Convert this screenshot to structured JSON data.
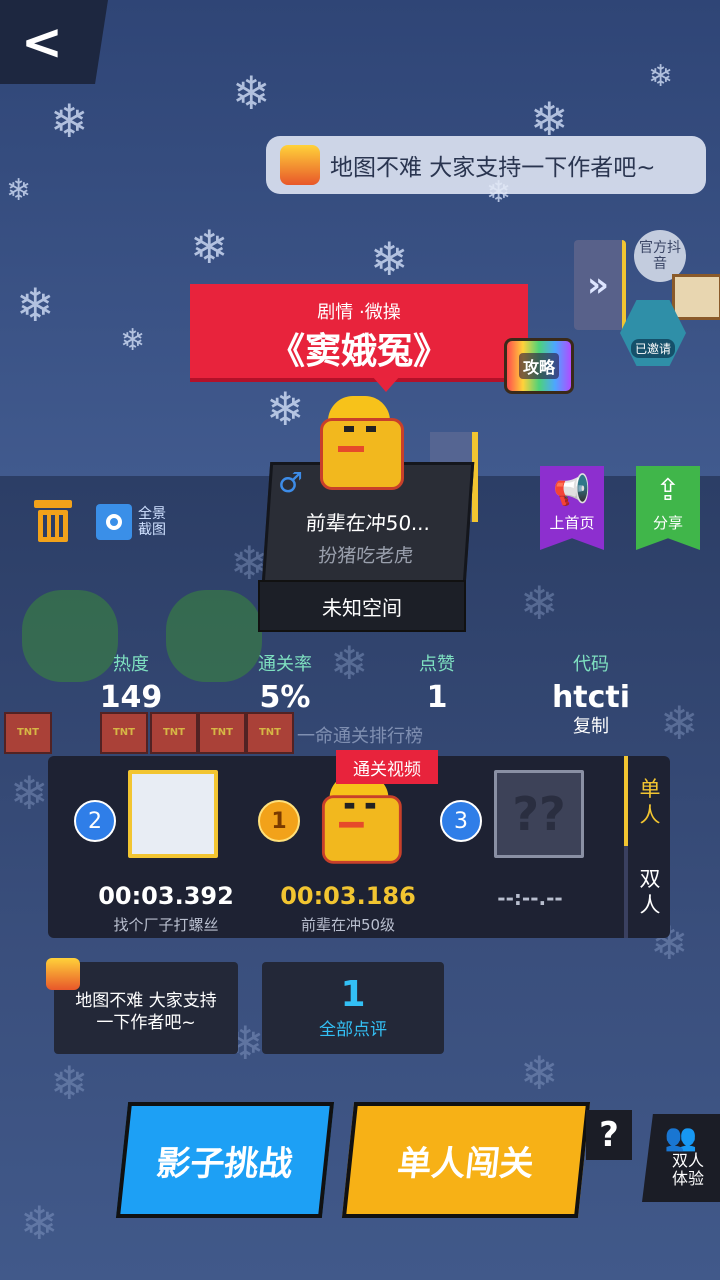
{
  "header": {
    "back_icon": "chevron-left-icon",
    "message": "地图不难 大家支持一下作者吧~"
  },
  "side": {
    "douyin_label": "官方抖音",
    "arrow_icon": "double-chevron-right-icon",
    "badge_label": "已邀请"
  },
  "level": {
    "tags": "剧情 ·微操",
    "title": "《窦娥冤》",
    "guide_label": "攻略"
  },
  "author": {
    "gender_icon": "male-icon",
    "name": "前辈在冲50...",
    "title": "扮猪吃老虎",
    "space": "未知空间"
  },
  "tools": {
    "screenshot_label": "全景截图"
  },
  "actions": {
    "home_label": "上首页",
    "share_label": "分享"
  },
  "stats": {
    "heat_label": "热度",
    "heat_value": "149",
    "pass_label": "通关率",
    "pass_value": "5%",
    "likes_label": "点赞",
    "likes_value": "1",
    "code_label": "代码",
    "code_value": "htcti",
    "copy_label": "复制"
  },
  "leaderboard": {
    "title": "一命通关排行榜",
    "video_label": "通关视频",
    "entries": [
      {
        "rank": "2",
        "time": "00:03.392",
        "name": "找个厂子打螺丝"
      },
      {
        "rank": "1",
        "time": "00:03.186",
        "name": "前辈在冲50级"
      },
      {
        "rank": "3",
        "time": "--:--.--",
        "name": ""
      }
    ],
    "mode_single": "单人",
    "mode_double": "双人"
  },
  "comments": {
    "latest": "地图不难 大家支持一下作者吧~",
    "count": "1",
    "all_label": "全部点评"
  },
  "buttons": {
    "shadow": "影子挑战",
    "solo": "单人闯关",
    "help": "?",
    "duo": "双人体验"
  },
  "colors": {
    "banner_red": "#e8233c",
    "shadow_blue": "#1da0f5",
    "solo_yellow": "#f7b116",
    "home_purple": "#8d2fcf",
    "share_green": "#40b64a"
  }
}
